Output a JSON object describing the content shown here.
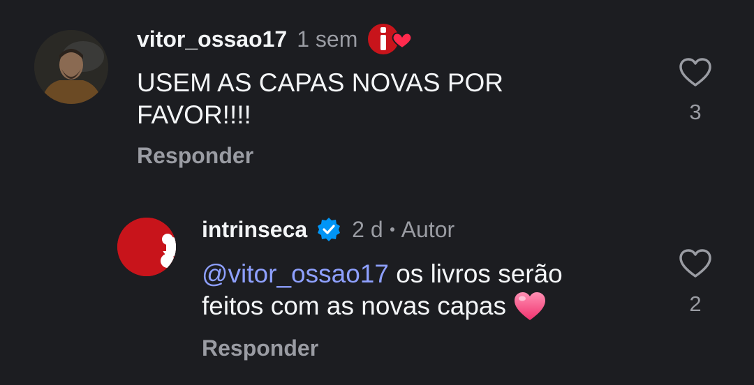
{
  "comment": {
    "username": "vitor_ossao17",
    "time": "1 sem",
    "badge_icon": "intrinseca-fan-heart-badge",
    "text_line1": "USEM AS CAPAS NOVAS POR",
    "text_line2": "FAVOR!!!!",
    "reply_label": "Responder",
    "like_icon": "heart-outline-icon",
    "like_count": "3"
  },
  "reply": {
    "username": "intrinseca",
    "verified_icon": "verified-badge-icon",
    "time": "2 d",
    "author_label": "Autor",
    "mention": "@vitor_ossao17",
    "text_rest": " os livros serão",
    "text_line2": "feitos com as novas capas",
    "emoji": "pink-heart",
    "reply_label": "Responder",
    "like_icon": "heart-outline-icon",
    "like_count": "2"
  },
  "colors": {
    "background": "#1c1d21",
    "text_primary": "#f3f5f7",
    "text_secondary": "#9a9ca3",
    "mention": "#8ea0ff",
    "brand_red": "#c8141b",
    "verified_blue": "#0095f6"
  }
}
